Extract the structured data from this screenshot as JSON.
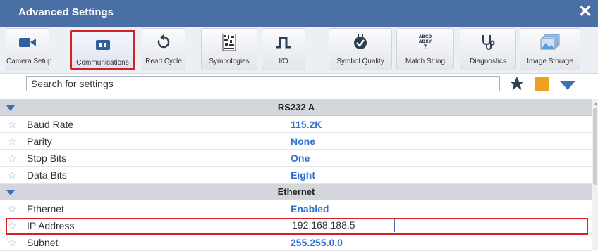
{
  "window": {
    "title": "Advanced Settings"
  },
  "toolbar": {
    "items": [
      {
        "label": "Camera Setup",
        "icon": "video-camera-icon",
        "active": false
      },
      {
        "label": "Communications",
        "icon": "network-port-icon",
        "active": true
      },
      {
        "label": "Read Cycle",
        "icon": "refresh-cycle-icon",
        "active": false
      },
      {
        "label": "Symbologies",
        "icon": "barcode-icon",
        "active": false
      },
      {
        "label": "I/O",
        "icon": "pulse-signal-icon",
        "active": false
      },
      {
        "label": "Symbol Quality",
        "icon": "quality-badge-icon",
        "active": false
      },
      {
        "label": "Match String",
        "icon": "match-string-icon",
        "active": false
      },
      {
        "label": "Diagnostics",
        "icon": "stethoscope-icon",
        "active": false
      },
      {
        "label": "Image Storage",
        "icon": "image-stack-icon",
        "active": false
      }
    ]
  },
  "search": {
    "placeholder": "Search for settings"
  },
  "search_actions": [
    {
      "icon": "favorites-star-icon",
      "color": "#2c3e50"
    },
    {
      "icon": "orange-square-icon",
      "color": "#f0a020"
    },
    {
      "icon": "dropdown-triangle-icon",
      "color": "#3f6fb8"
    }
  ],
  "sections": [
    {
      "title": "RS232 A",
      "rows": [
        {
          "name": "Baud Rate",
          "value": "115.2K"
        },
        {
          "name": "Parity",
          "value": "None"
        },
        {
          "name": "Stop Bits",
          "value": "One"
        },
        {
          "name": "Data Bits",
          "value": "Eight"
        }
      ]
    },
    {
      "title": "Ethernet",
      "rows": [
        {
          "name": "Ethernet",
          "value": "Enabled"
        },
        {
          "name": "IP Address",
          "value": "192.168.188.5",
          "editing": true
        },
        {
          "name": "Subnet",
          "value": "255.255.0.0"
        }
      ]
    }
  ],
  "colors": {
    "titlebar": "#4a6fa5",
    "accent": "#2f6fd1",
    "highlight": "#d71f26"
  }
}
